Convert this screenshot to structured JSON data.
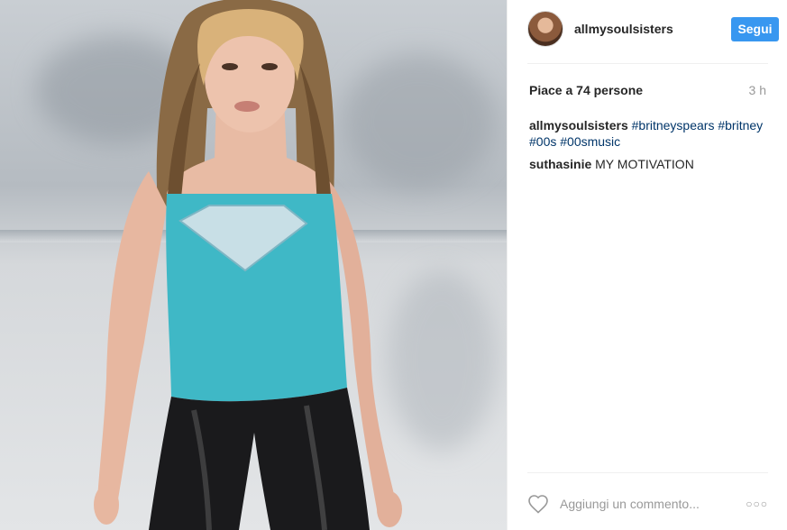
{
  "header": {
    "username": "allmysoulsisters",
    "follow_label": "Segui"
  },
  "stats": {
    "likes": "Piace a 74 persone",
    "time": "3 h"
  },
  "caption": {
    "user": "allmysoulsisters",
    "hashtags": [
      "#britneyspears",
      "#britney",
      "#00s",
      "#00smusic"
    ]
  },
  "comments": [
    {
      "user": "suthasinie",
      "text": "MY MOTIVATION"
    }
  ],
  "add_comment": {
    "placeholder": "Aggiungi un commento..."
  },
  "icons": {
    "like": "heart-icon",
    "options": "more-options-icon"
  },
  "colors": {
    "accent": "#3897f0",
    "hashtag": "#003569",
    "muted": "#999999"
  }
}
